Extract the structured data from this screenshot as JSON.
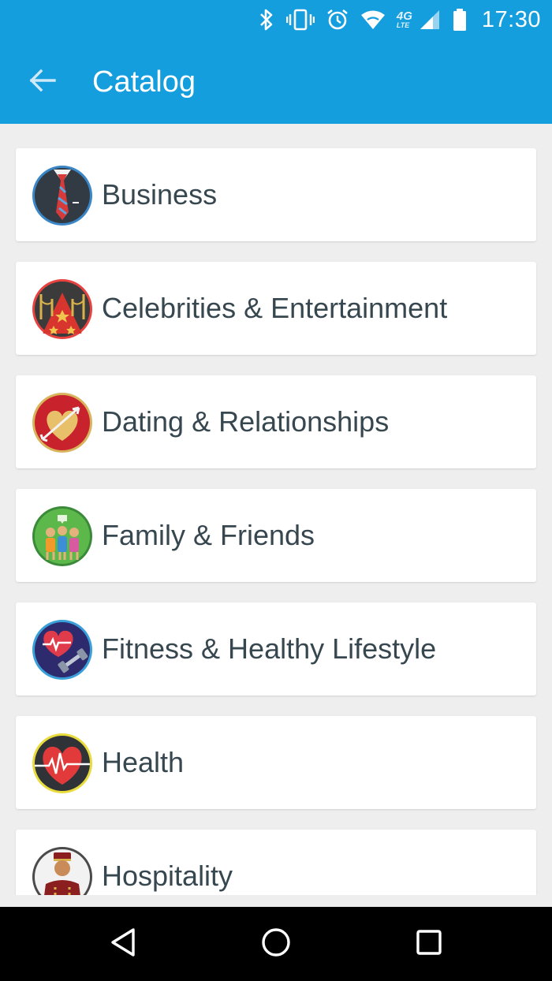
{
  "status_bar": {
    "time": "17:30",
    "network": "4G",
    "network_sub": "LTE",
    "icons": [
      "bluetooth-icon",
      "vibrate-icon",
      "alarm-icon",
      "wifi-icon",
      "signal-icon",
      "battery-icon"
    ]
  },
  "app_bar": {
    "title": "Catalog",
    "back_icon": "arrow-back-icon",
    "background": "#149ede"
  },
  "catalog": {
    "items": [
      {
        "label": "Business",
        "icon": "business-suit-icon"
      },
      {
        "label": "Celebrities & Entertainment",
        "icon": "red-carpet-icon"
      },
      {
        "label": "Dating & Relationships",
        "icon": "heart-arrow-icon"
      },
      {
        "label": "Family & Friends",
        "icon": "family-group-icon"
      },
      {
        "label": "Fitness & Healthy Lifestyle",
        "icon": "heart-dumbbell-icon"
      },
      {
        "label": "Health",
        "icon": "heartbeat-icon"
      },
      {
        "label": "Hospitality",
        "icon": "bellhop-icon"
      }
    ]
  },
  "nav_bar": {
    "back": "triangle-back-icon",
    "home": "circle-home-icon",
    "recents": "square-recents-icon"
  }
}
